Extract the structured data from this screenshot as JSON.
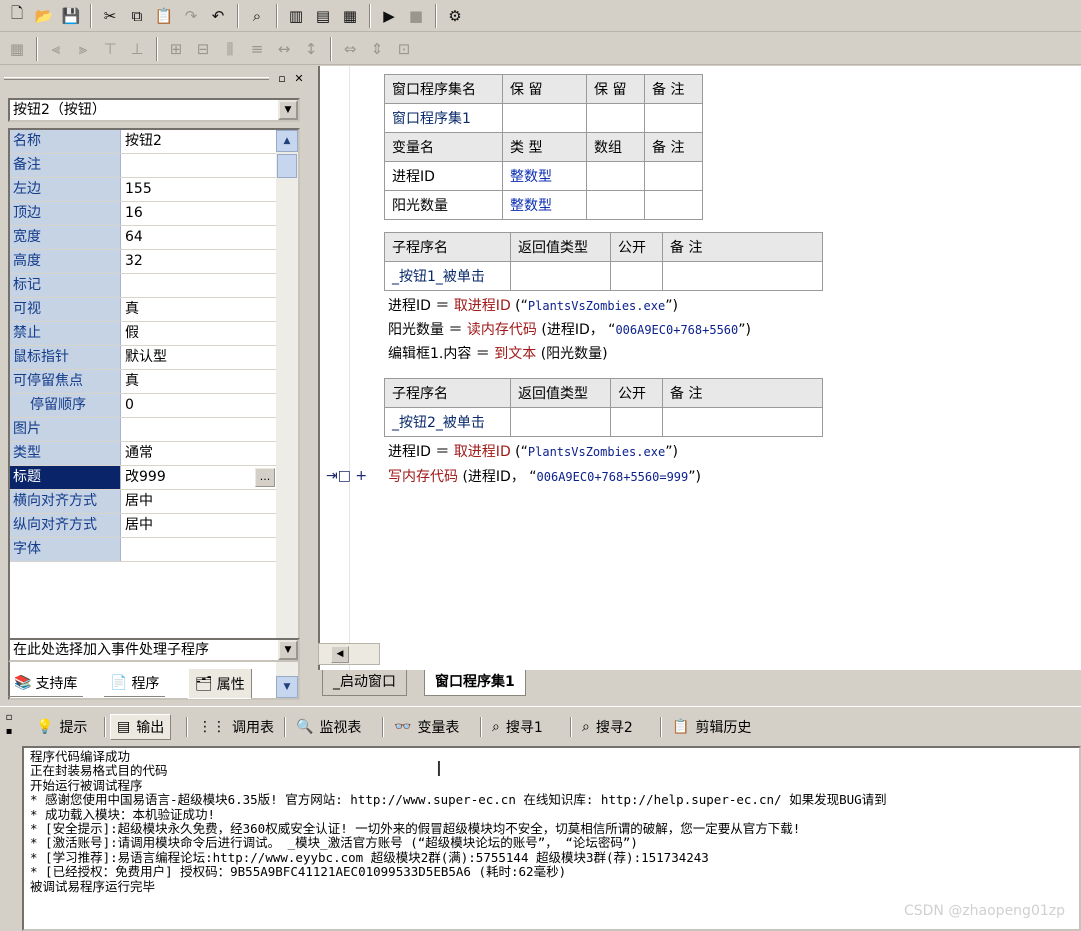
{
  "toolbar1": {
    "icons": [
      "new-file-icon",
      "open-folder-icon",
      "save-icon",
      "cut-icon",
      "copy-icon",
      "paste-icon",
      "redo-icon",
      "undo-icon",
      "find-icon",
      "layout-left-icon",
      "layout-top-icon",
      "layout-grid-icon",
      "run-icon",
      "stop-icon",
      "debug-icon"
    ]
  },
  "property_panel": {
    "object_selector": "按钮2（按钮）",
    "properties": [
      {
        "name": "名称",
        "value": "按钮2"
      },
      {
        "name": "备注",
        "value": ""
      },
      {
        "name": "左边",
        "value": "155"
      },
      {
        "name": "顶边",
        "value": "16"
      },
      {
        "name": "宽度",
        "value": "64"
      },
      {
        "name": "高度",
        "value": "32"
      },
      {
        "name": "标记",
        "value": ""
      },
      {
        "name": "可视",
        "value": "真"
      },
      {
        "name": "禁止",
        "value": "假"
      },
      {
        "name": "鼠标指针",
        "value": "默认型"
      },
      {
        "name": "可停留焦点",
        "value": "真"
      },
      {
        "name": "停留顺序",
        "value": "0"
      },
      {
        "name": "图片",
        "value": ""
      },
      {
        "name": "类型",
        "value": "通常"
      },
      {
        "name": "标题",
        "value": "改999"
      },
      {
        "name": "横向对齐方式",
        "value": "居中"
      },
      {
        "name": "纵向对齐方式",
        "value": "居中"
      },
      {
        "name": "字体",
        "value": ""
      }
    ],
    "ellipsis": "...",
    "event_selector": "在此处选择加入事件处理子程序",
    "tabs": [
      {
        "label": "支持库"
      },
      {
        "label": "程序"
      },
      {
        "label": "属性"
      }
    ]
  },
  "editor": {
    "assembly_table": {
      "headers": [
        "窗口程序集名",
        "保 留",
        "保 留",
        "备 注"
      ],
      "row": [
        "窗口程序集1",
        "",
        "",
        ""
      ],
      "var_headers": [
        "变量名",
        "类 型",
        "数组",
        "备 注"
      ],
      "vars": [
        [
          "进程ID",
          "整数型",
          "",
          ""
        ],
        [
          "阳光数量",
          "整数型",
          "",
          ""
        ]
      ]
    },
    "sub1": {
      "headers": [
        "子程序名",
        "返回值类型",
        "公开",
        "备 注"
      ],
      "name": "_按钮1_被单击",
      "lines": [
        {
          "a": "进程ID ＝ ",
          "kw": "取进程ID",
          "b": " (“",
          "s": "PlantsVsZombies.exe",
          "c": "”)"
        },
        {
          "a": "阳光数量 ＝ ",
          "kw": "读内存代码",
          "b": " (进程ID， “",
          "s": "006A9EC0+768+5560",
          "c": "”)"
        },
        {
          "a": "编辑框1.内容 ＝ ",
          "kw": "到文本",
          "b": " (阳光数量)",
          "s": "",
          "c": ""
        }
      ]
    },
    "sub2": {
      "headers": [
        "子程序名",
        "返回值类型",
        "公开",
        "备 注"
      ],
      "name": "_按钮2_被单击",
      "lines": [
        {
          "a": "进程ID ＝ ",
          "kw": "取进程ID",
          "b": " (“",
          "s": "PlantsVsZombies.exe",
          "c": "”)"
        },
        {
          "a": "",
          "kw": "写内存代码",
          "b": " (进程ID， “",
          "s": "006A9EC0+768+5560=999",
          "c": "”)"
        }
      ]
    },
    "marker": "+",
    "tabs": [
      "_启动窗口",
      "窗口程序集1"
    ]
  },
  "output_tabs": [
    "提示",
    "输出",
    "调用表",
    "监视表",
    "变量表",
    "搜寻1",
    "搜寻2",
    "剪辑历史"
  ],
  "output_lines": [
    "程序代码编译成功",
    "正在封装易格式目的代码",
    "开始运行被调试程序",
    "* 感谢您使用中国易语言-超级模块6.35版! 官方网站: http://www.super-ec.cn  在线知识库: http://help.super-ec.cn/  如果发现BUG请到",
    "* 成功载入模块：本机验证成功!",
    "* [安全提示]:超级模块永久免费，经360权威安全认证! 一切外来的假冒超级模块均不安全，切莫相信所谓的破解，您一定要从官方下载!",
    "* [激活账号]:请调用模块命令后进行调试。    _模块_激活官方账号 (“超级模块论坛的账号”， “论坛密码”)",
    "* [学习推荐]:易语言编程论坛:http://www.eyybc.com   超级模块2群(满):5755144 超级模块3群(荐):151734243",
    "* [已经授权：免费用户] 授权码：9B55A9BFC41121AEC01099533D5EB5A6    (耗时:62毫秒)",
    "被调试易程序运行完毕"
  ],
  "watermark": "CSDN @zhaopeng01zp"
}
